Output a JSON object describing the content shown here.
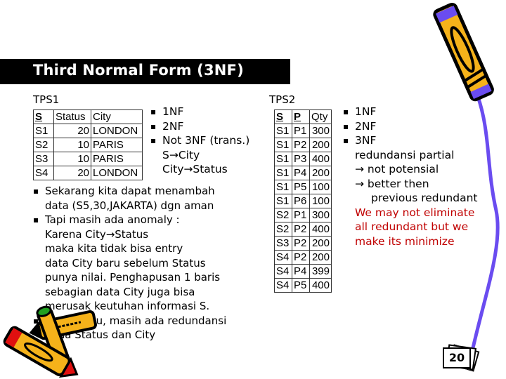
{
  "slide": {
    "title": "Third Normal Form (3NF)",
    "page_number": "20"
  },
  "tps1": {
    "label": "TPS1",
    "headers": [
      "S",
      "Status",
      "City"
    ],
    "rows": [
      [
        "S1",
        "20",
        "LONDON"
      ],
      [
        "S2",
        "10",
        "PARIS"
      ],
      [
        "S3",
        "10",
        "PARIS"
      ],
      [
        "S4",
        "20",
        "LONDON"
      ]
    ]
  },
  "tps1_notes": {
    "bullets": [
      "1NF",
      "2NF",
      "Not 3NF (trans.)"
    ],
    "deps": [
      "S→City",
      "City→Status"
    ]
  },
  "tps2": {
    "label": "TPS2",
    "headers": [
      "S",
      "P",
      "Qty"
    ],
    "rows": [
      [
        "S1",
        "P1",
        "300"
      ],
      [
        "S1",
        "P2",
        "200"
      ],
      [
        "S1",
        "P3",
        "400"
      ],
      [
        "S1",
        "P4",
        "200"
      ],
      [
        "S1",
        "P5",
        "100"
      ],
      [
        "S1",
        "P6",
        "100"
      ],
      [
        "S2",
        "P1",
        "300"
      ],
      [
        "S2",
        "P2",
        "400"
      ],
      [
        "S3",
        "P2",
        "200"
      ],
      [
        "S4",
        "P2",
        "200"
      ],
      [
        "S4",
        "P4",
        "399"
      ],
      [
        "S4",
        "P5",
        "400"
      ]
    ]
  },
  "explanation": {
    "b1_l1": "Sekarang kita dapat menambah",
    "b1_l2": "data (S5,30,JAKARTA) dgn aman",
    "b2_l1": "Tapi masih ada anomaly :",
    "b2_l2": "Karena City→Status",
    "b2_l3": "maka kita tidak bisa entry",
    "b2_l4": "data City baru sebelum Status",
    "b2_l5": "punya nilai. Penghapusan 1 baris",
    "b2_l6": "sebagian data City juga bisa",
    "b2_l7": "merusak keutuhan informasi S.",
    "b3_l1": "Tapi begitu, masih ada redundansi",
    "b3_l2": "pada Status dan City"
  },
  "tps2_notes": {
    "bullets": [
      "1NF",
      "2NF",
      "3NF"
    ],
    "l1": "redundansi partial",
    "l2": "→ not potensial",
    "l3": "→ better then",
    "l4": "previous redundant",
    "red_l1": "We may not eliminate",
    "red_l2": "all redundant but we",
    "red_l3": "make its minimize"
  },
  "colors": {
    "title_bg": "#000000",
    "accent_red": "#c00000",
    "crayon_yellow": "#f5b21a",
    "crayon_purple": "#6a4cf0",
    "crayon_red": "#e01010",
    "crayon_green": "#20a020"
  }
}
